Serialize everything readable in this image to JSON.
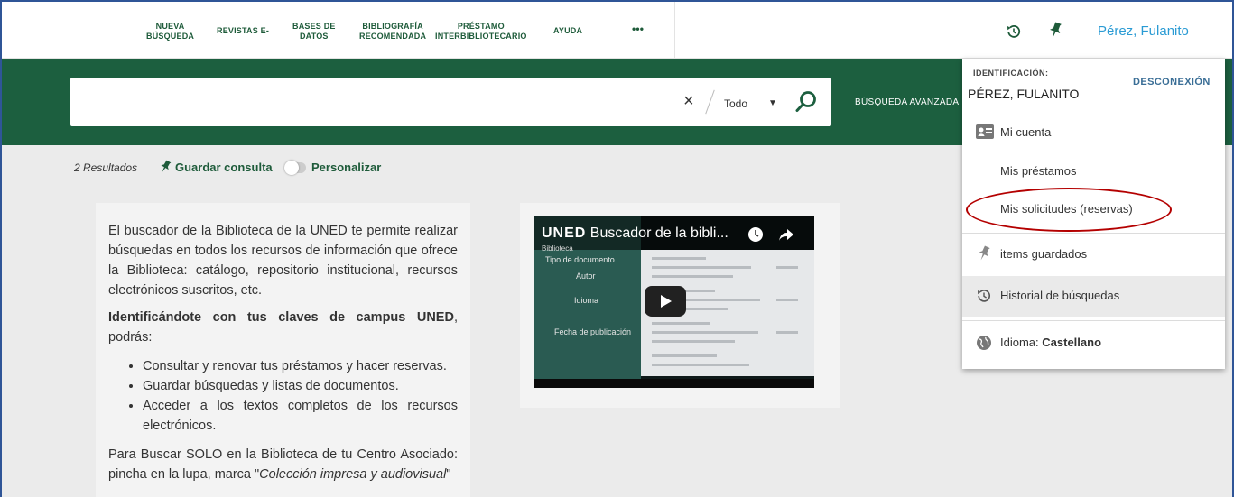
{
  "nav": {
    "items": [
      {
        "line1": "NUEVA",
        "line2": "BÚSQUEDA"
      },
      {
        "line1": "REVISTAS E-",
        "line2": ""
      },
      {
        "line1": "BASES DE",
        "line2": "DATOS"
      },
      {
        "line1": "BIBLIOGRAFÍA",
        "line2": "RECOMENDADA"
      },
      {
        "line1": "PRÉSTAMO",
        "line2": "INTERBIBLIOTECARIO"
      },
      {
        "line1": "AYUDA",
        "line2": ""
      },
      {
        "line1": "•••",
        "line2": ""
      }
    ],
    "user_name": "Pérez, Fulanito"
  },
  "search": {
    "query": "",
    "clear": "×",
    "scope": "Todo",
    "advanced": "BÚSQUEDA AVANZADA"
  },
  "results": {
    "count": "2 Resultados",
    "save_query": "Guardar consulta",
    "personalize": "Personalizar"
  },
  "info": {
    "p1": "El buscador de la Biblioteca de la UNED te permite realizar búsquedas en todos los recursos de información que ofrece la Biblioteca: catálogo, repositorio institucional, recursos electrónicos suscritos, etc.",
    "p2_bold": "Identificándote con tus claves de campus UNED",
    "p2_rest": ", podrás:",
    "bullets": [
      "Consultar y renovar tus préstamos y hacer reservas.",
      "Guardar búsquedas y listas de documentos.",
      "Acceder a los textos completos de los recursos electrónicos."
    ],
    "p3_start": "Para Buscar SOLO en la Biblioteca de tu Centro Asociado: pincha en la lupa, marca \"",
    "p3_italic": "Colección impresa y audiovisual",
    "p3_end": "\""
  },
  "video": {
    "brand": "UNED",
    "title": "Buscador de la bibli...",
    "subtitle": "Biblioteca",
    "labels": [
      "Tipo de documento",
      "Autor",
      "Idioma",
      "Fecha de publicación"
    ]
  },
  "dropdown": {
    "ident_label": "IDENTIFICACIÓN:",
    "ident_name": "PÉREZ, FULANITO",
    "logout": "DESCONEXIÓN",
    "items": {
      "account": "Mi cuenta",
      "loans": "Mis préstamos",
      "requests": "Mis solicitudes (reservas)",
      "saved": "items guardados",
      "history": "Historial de búsquedas",
      "language_label": "Idioma:",
      "language_value": "Castellano"
    }
  },
  "colors": {
    "brand_green": "#1c5f3f",
    "link_blue": "#2a9bd4",
    "annotation_red": "#b40000"
  }
}
